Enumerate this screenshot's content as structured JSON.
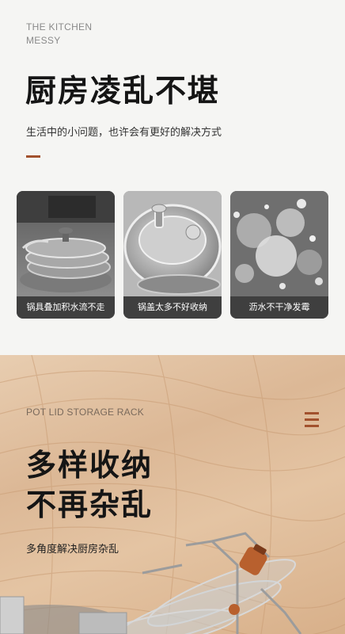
{
  "top": {
    "eyebrow_line1": "THE KITCHEN",
    "eyebrow_line2": "MESSY",
    "title": "厨房凌乱不堪",
    "subtitle": "生活中的小问题，也许会有更好的解决方式",
    "accent_color": "#a2512d",
    "cards": [
      {
        "caption": "锅具叠加积水流不走",
        "icon": "stacked-pots"
      },
      {
        "caption": "锅盖太多不好收纳",
        "icon": "pot-lid"
      },
      {
        "caption": "沥水不干净发霉",
        "icon": "moldy-water"
      }
    ]
  },
  "bottom": {
    "eyebrow": "POT LID STORAGE RACK",
    "title_line1": "多样收纳",
    "title_line2": "不再杂乱",
    "subtitle": "多角度解决厨房杂乱",
    "menu_icon": "hamburger-menu-icon"
  }
}
